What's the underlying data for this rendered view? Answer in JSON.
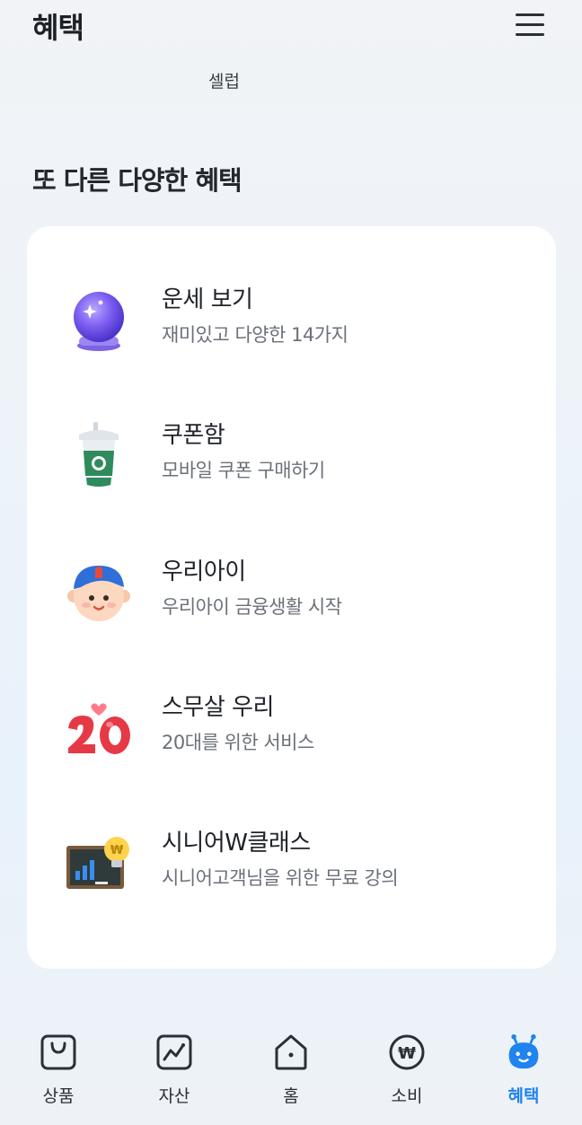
{
  "header": {
    "title": "혜택",
    "menu_icon": "hamburger-menu-icon"
  },
  "partial_label": "셀럽",
  "section": {
    "title": "또 다른 다양한 혜택"
  },
  "benefits": [
    {
      "title": "운세 보기",
      "subtitle": "재미있고 다양한 14가지",
      "icon": "crystal-ball-icon"
    },
    {
      "title": "쿠폰함",
      "subtitle": "모바일 쿠폰 구매하기",
      "icon": "coffee-cup-icon"
    },
    {
      "title": "우리아이",
      "subtitle": "우리아이 금융생활 시작",
      "icon": "kid-face-icon"
    },
    {
      "title": "스무살 우리",
      "subtitle": "20대를 위한 서비스",
      "icon": "twenty-heart-icon"
    },
    {
      "title": "시니어W클래스",
      "subtitle": "시니어고객님을 위한 무료 강의",
      "icon": "chalkboard-bulb-icon"
    }
  ],
  "tabbar": {
    "active": "혜택",
    "active_color": "#1f83f0",
    "tabs": [
      {
        "label": "상품",
        "icon": "shopping-bag-icon"
      },
      {
        "label": "자산",
        "icon": "chart-icon"
      },
      {
        "label": "홈",
        "icon": "home-icon"
      },
      {
        "label": "소비",
        "icon": "won-coin-icon"
      },
      {
        "label": "혜택",
        "icon": "mascot-icon"
      }
    ]
  }
}
